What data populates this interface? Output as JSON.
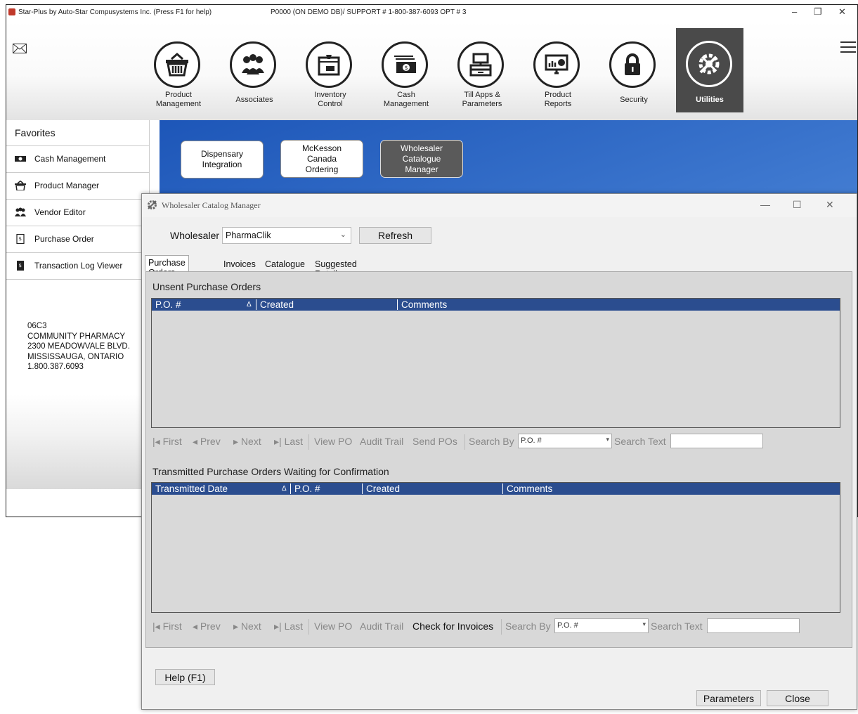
{
  "app": {
    "title": "Star-Plus by Auto-Star Compusystems Inc. (Press F1 for help)",
    "info": "P0000 (ON DEMO DB)/ SUPPORT # 1-800-387-6093 OPT # 3"
  },
  "toolbar": {
    "items": [
      {
        "label": "Product\nManagement",
        "icon": "basket-icon"
      },
      {
        "label": "Associates",
        "icon": "people-icon"
      },
      {
        "label": "Inventory\nControl",
        "icon": "box-icon"
      },
      {
        "label": "Cash\nManagement",
        "icon": "cash-icon"
      },
      {
        "label": "Till Apps &\nParameters",
        "icon": "register-icon"
      },
      {
        "label": "Product\nReports",
        "icon": "chart-monitor-icon"
      },
      {
        "label": "Security",
        "icon": "lock-icon"
      },
      {
        "label": "Utilities",
        "icon": "tools-gear-icon",
        "active": true
      }
    ]
  },
  "favorites": {
    "title": "Favorites",
    "items": [
      {
        "label": "Cash Management",
        "icon": "cash-icon"
      },
      {
        "label": "Product Manager",
        "icon": "basket-icon"
      },
      {
        "label": "Vendor Editor",
        "icon": "people-icon"
      },
      {
        "label": "Purchase Order",
        "icon": "document-icon"
      },
      {
        "label": "Transaction Log Viewer",
        "icon": "dollar-doc-icon"
      }
    ],
    "store": [
      "06C3",
      "COMMUNITY PHARMACY",
      "2300 MEADOWVALE BLVD.",
      "MISSISSAUGA, ONTARIO",
      "1.800.387.6093"
    ]
  },
  "submenu": {
    "items": [
      {
        "label": "Dispensary\nIntegration"
      },
      {
        "label": "McKesson\nCanada\nOrdering"
      },
      {
        "label": "Wholesaler\nCatalogue\nManager",
        "active": true
      }
    ]
  },
  "dialog": {
    "title": "Wholesaler Catalog Manager",
    "wholesaler_label": "Wholesaler",
    "wholesaler_value": "PharmaClik",
    "refresh": "Refresh",
    "tabs": [
      "Purchase Orders",
      "Invoices",
      "Catalogue",
      "Suggested Retail"
    ],
    "active_tab": "Purchase Orders",
    "unsent": {
      "title": "Unsent Purchase Orders",
      "columns": [
        "P.O. #",
        "Created",
        "Comments"
      ],
      "sort_marker": "Δ",
      "nav": [
        "First",
        "Prev",
        "Next",
        "Last",
        "View PO",
        "Audit Trail",
        "Send POs"
      ],
      "search_by_label": "Search By",
      "search_by_value": "P.O. #",
      "search_text_label": "Search Text"
    },
    "transmitted": {
      "title": "Transmitted Purchase Orders Waiting for Confirmation",
      "columns": [
        "Transmitted Date",
        "P.O. #",
        "Created",
        "Comments"
      ],
      "sort_marker": "Δ",
      "nav": [
        "First",
        "Prev",
        "Next",
        "Last",
        "View PO",
        "Audit Trail",
        "Check for Invoices"
      ],
      "search_by_label": "Search By",
      "search_by_value": "P.O. #",
      "search_text_label": "Search Text"
    },
    "help": "Help (F1)",
    "parameters": "Parameters",
    "close": "Close"
  }
}
